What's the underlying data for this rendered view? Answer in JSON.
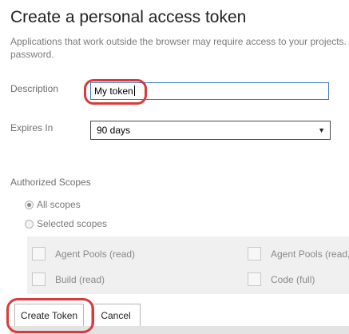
{
  "page": {
    "title": "Create a personal access token",
    "intro_line1": "Applications that work outside the browser may require access to your projects.",
    "intro_line2": "password."
  },
  "form": {
    "description_label": "Description",
    "description_value": "My token",
    "expires_label": "Expires In",
    "expires_value": "90 days",
    "scopes_label": "Authorized Scopes",
    "radio_all": "All scopes",
    "radio_all_checked": true,
    "radio_selected": "Selected scopes",
    "scopes": [
      {
        "label": "Agent Pools (read)"
      },
      {
        "label": "Agent Pools (read,"
      },
      {
        "label": "Build (read)"
      },
      {
        "label": "Code (full)"
      }
    ]
  },
  "buttons": {
    "create": "Create Token",
    "cancel": "Cancel"
  },
  "colors": {
    "annotation": "#d93a3a",
    "input_focus_border": "#3e7bc7"
  },
  "icons": {
    "dropdown": "chevron-down-icon"
  }
}
